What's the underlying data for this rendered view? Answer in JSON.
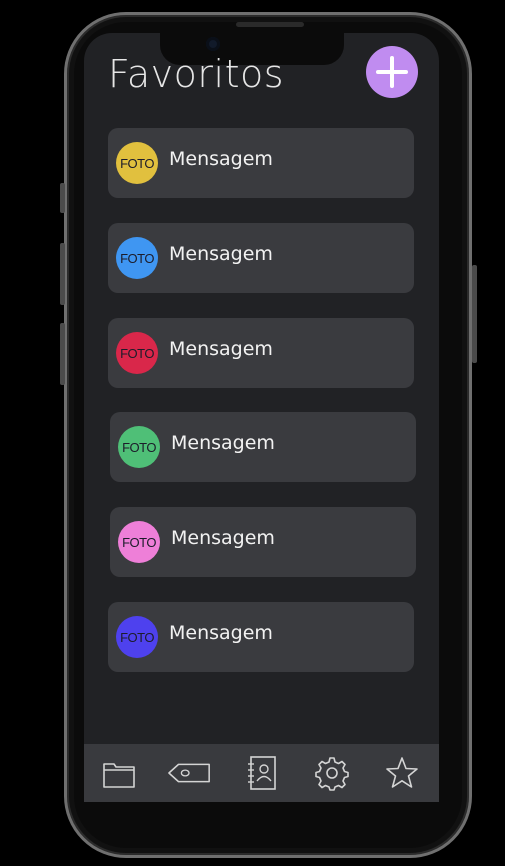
{
  "header": {
    "title": "Favoritos"
  },
  "favorites": [
    {
      "avatar_label": "FOTO",
      "avatar_color": "#e1c03e",
      "message": "Mensagem"
    },
    {
      "avatar_label": "FOTO",
      "avatar_color": "#3f96f2",
      "message": "Mensagem"
    },
    {
      "avatar_label": "FOTO",
      "avatar_color": "#d9274a",
      "message": "Mensagem"
    },
    {
      "avatar_label": "FOTO",
      "avatar_color": "#4fbf77",
      "message": "Mensagem"
    },
    {
      "avatar_label": "FOTO",
      "avatar_color": "#ee7fd8",
      "message": "Mensagem"
    },
    {
      "avatar_label": "FOTO",
      "avatar_color": "#4e41ee",
      "message": "Mensagem"
    }
  ],
  "colors": {
    "accent": "#c08cf0",
    "background": "#212225",
    "card": "#3a3b3f"
  },
  "tabbar": {
    "items": [
      "folder-icon",
      "tag-icon",
      "contacts-book-icon",
      "gear-icon",
      "star-icon"
    ]
  }
}
